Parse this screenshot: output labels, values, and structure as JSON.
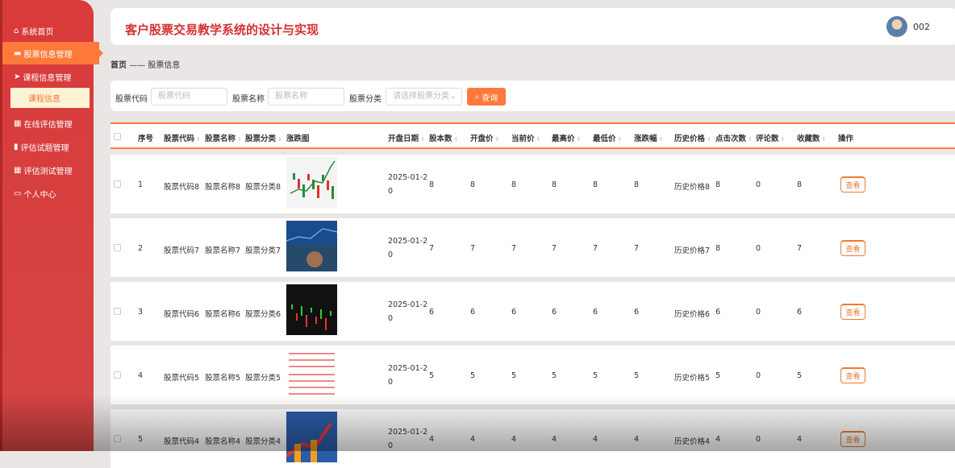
{
  "sidebar": {
    "items": [
      {
        "label": "系统首页",
        "icon": "home-icon"
      },
      {
        "label": "股票信息管理",
        "icon": "briefcase-icon"
      },
      {
        "label": "课程信息管理",
        "icon": "send-icon"
      },
      {
        "label": "课程信息",
        "icon": ""
      },
      {
        "label": "在线评估管理",
        "icon": "grid-icon"
      },
      {
        "label": "评估试题管理",
        "icon": "book-icon"
      },
      {
        "label": "评估测试管理",
        "icon": "grid-icon"
      },
      {
        "label": "个人中心",
        "icon": "card-icon"
      }
    ]
  },
  "header": {
    "title": "客户股票交易教学系统的设计与实现",
    "user": "002"
  },
  "breadcrumb": {
    "home": "首页",
    "sep": "——",
    "current": "股票信息"
  },
  "search": {
    "code_label": "股票代码",
    "code_placeholder": "股票代码",
    "name_label": "股票名称",
    "name_placeholder": "股票名称",
    "cat_label": "股票分类",
    "cat_placeholder": "请选择股票分类",
    "button": "查询"
  },
  "table": {
    "headers": [
      "序号",
      "股票代码",
      "股票名称",
      "股票分类",
      "涨跌图",
      "开盘日期",
      "股本数",
      "开盘价",
      "当前价",
      "最高价",
      "最低价",
      "涨跌幅",
      "历史价格",
      "点击次数",
      "评论数",
      "收藏数",
      "操作"
    ],
    "rows": [
      {
        "no": "1",
        "code": "股票代码8",
        "name": "股票名称8",
        "cat": "股票分类8",
        "date1": "2025-01-2",
        "date2": "0",
        "shares": "8",
        "open": "8",
        "cur": "8",
        "high": "8",
        "low": "8",
        "chg": "8",
        "hist": "历史价格8",
        "clicks": "8",
        "comments": "0",
        "favs": "8",
        "action": "查看"
      },
      {
        "no": "2",
        "code": "股票代码7",
        "name": "股票名称7",
        "cat": "股票分类7",
        "date1": "2025-01-2",
        "date2": "0",
        "shares": "7",
        "open": "7",
        "cur": "7",
        "high": "7",
        "low": "7",
        "chg": "7",
        "hist": "历史价格7",
        "clicks": "8",
        "comments": "0",
        "favs": "7",
        "action": "查看"
      },
      {
        "no": "3",
        "code": "股票代码6",
        "name": "股票名称6",
        "cat": "股票分类6",
        "date1": "2025-01-2",
        "date2": "0",
        "shares": "6",
        "open": "6",
        "cur": "6",
        "high": "6",
        "low": "6",
        "chg": "6",
        "hist": "历史价格6",
        "clicks": "6",
        "comments": "0",
        "favs": "6",
        "action": "查看"
      },
      {
        "no": "4",
        "code": "股票代码5",
        "name": "股票名称5",
        "cat": "股票分类5",
        "date1": "2025-01-2",
        "date2": "0",
        "shares": "5",
        "open": "5",
        "cur": "5",
        "high": "5",
        "low": "5",
        "chg": "5",
        "hist": "历史价格5",
        "clicks": "5",
        "comments": "0",
        "favs": "5",
        "action": "查看"
      },
      {
        "no": "5",
        "code": "股票代码4",
        "name": "股票名称4",
        "cat": "股票分类4",
        "date1": "2025-01-2",
        "date2": "0",
        "shares": "4",
        "open": "4",
        "cur": "4",
        "high": "4",
        "low": "4",
        "chg": "4",
        "hist": "历史价格4",
        "clicks": "4",
        "comments": "0",
        "favs": "4",
        "action": "查看"
      }
    ]
  },
  "colors": {
    "sidebar": "#d93a3a",
    "accent": "#ff7a3a",
    "title": "#d53030"
  }
}
